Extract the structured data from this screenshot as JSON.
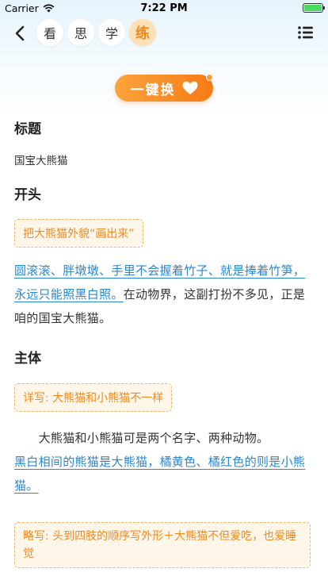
{
  "status": {
    "carrier": "Carrier",
    "time": "7:22 PM"
  },
  "nav": {
    "tabs": [
      {
        "label": "看"
      },
      {
        "label": "思"
      },
      {
        "label": "学"
      },
      {
        "label": "练"
      }
    ]
  },
  "swap": {
    "label": "一键换"
  },
  "sections": {
    "title_heading": "标题",
    "title_text": "国宝大熊猫",
    "opening_heading": "开头",
    "opening_tag": "把大熊猫外貌“画出来”",
    "opening_link": "圆滚滚、胖墩墩、手里不会握着竹子、就是捧着竹笋，永远只能照黑白照。",
    "opening_rest": "在动物界，这副打扮不多见，正是咱的国宝大熊猫。",
    "body_heading": "主体",
    "body_tag1": "详写: 大熊猫和小熊猫不一样",
    "body_para_text": "　　大熊猫和小熊猫可是两个名字、两种动物。",
    "body_para_link": "黑白相间的熊猫是大熊猫，橘黄色、橘红色的则是小熊猫。",
    "body_tag2": "略写: 头到四肢的顺序写外形＋大熊猫不但爱吃，也爱睡觉"
  },
  "colors": {
    "accent": "#f57b16",
    "link": "#2a87d0",
    "tag_border": "#f5b36a"
  }
}
